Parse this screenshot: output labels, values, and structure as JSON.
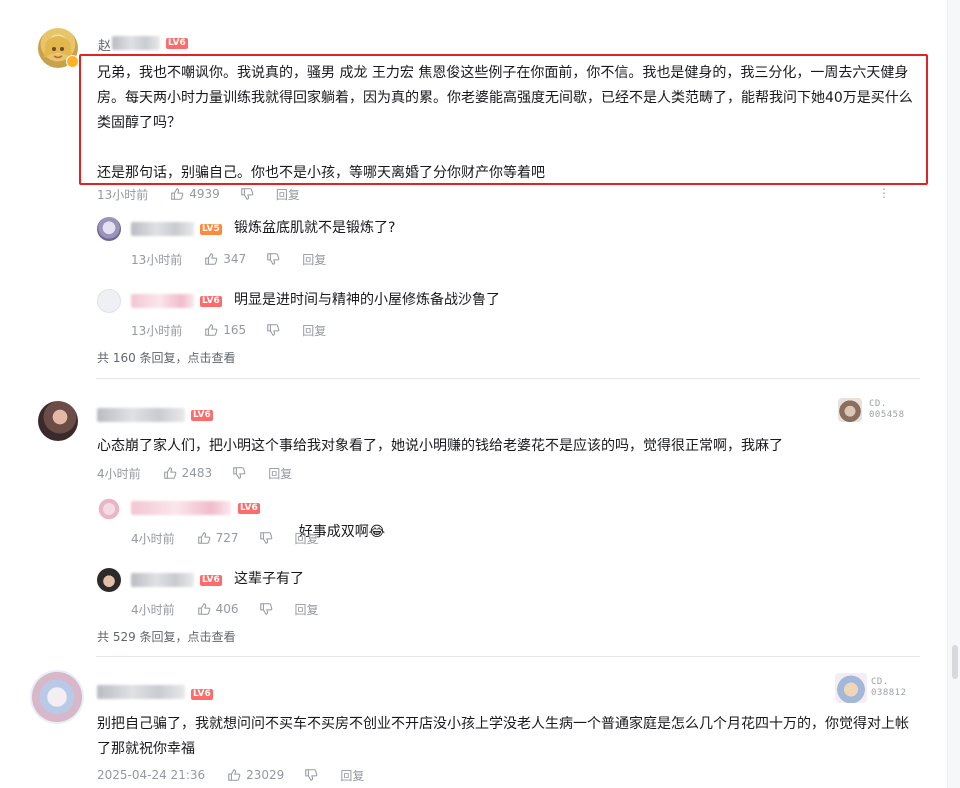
{
  "comments": [
    {
      "name_visible": "赵",
      "level": "LV6",
      "text": "兄弟，我也不嘲讽你。我说真的，骚男 成龙 王力宏 焦恩俊这些例子在你面前，你不信。我也是健身的，我三分化，一周去六天健身房。每天两小时力量训练我就得回家躺着，因为真的累。你老婆能高强度无间歇，已经不是人类范畴了，能帮我问下她40万是买什么类固醇了吗？\n\n还是那句话，别骗自己。你也不是小孩，等哪天离婚了分你财产你等着吧",
      "time": "13小时前",
      "likes": "4939",
      "reply_label": "回复",
      "more_icon": "⋮",
      "replies": [
        {
          "level": "LV5",
          "text": "锻炼盆底肌就不是锻炼了?",
          "time": "13小时前",
          "likes": "347",
          "reply_label": "回复"
        },
        {
          "level": "LV6",
          "text": "明显是进时间与精神的小屋修炼备战沙鲁了",
          "time": "13小时前",
          "likes": "165",
          "reply_label": "回复"
        }
      ],
      "more_replies": "共 160 条回复，",
      "more_link": "点击查看"
    },
    {
      "level": "LV6",
      "badge_line1": "CD.",
      "badge_line2": "005458",
      "text": "心态崩了家人们，把小明这个事给我对象看了，她说小明赚的钱给老婆花不是应该的吗，觉得很正常啊，我麻了",
      "time": "4小时前",
      "likes": "2483",
      "reply_label": "回复",
      "replies": [
        {
          "level": "LV6",
          "text": "好事成双啊",
          "emoji": "😂",
          "time": "4小时前",
          "likes": "727",
          "reply_label": "回复"
        },
        {
          "level": "LV6",
          "text": "这辈子有了",
          "time": "4小时前",
          "likes": "406",
          "reply_label": "回复"
        }
      ],
      "more_replies": "共 529 条回复，",
      "more_link": "点击查看"
    },
    {
      "level": "LV6",
      "badge_line1": "CD.",
      "badge_line2": "038812",
      "text": "别把自己骗了，我就想问问不买车不买房不创业不开店没小孩上学没老人生病一个普通家庭是怎么几个月花四十万的，你觉得对上帐了那就祝你幸福",
      "time": "2025-04-24 21:36",
      "likes": "23029",
      "reply_label": "回复"
    }
  ],
  "colors": {
    "highlight": "#e02424",
    "level": "#ff6b6b",
    "meta": "#9499a0"
  },
  "icons": [
    "like-icon",
    "dislike-icon",
    "more-icon"
  ]
}
